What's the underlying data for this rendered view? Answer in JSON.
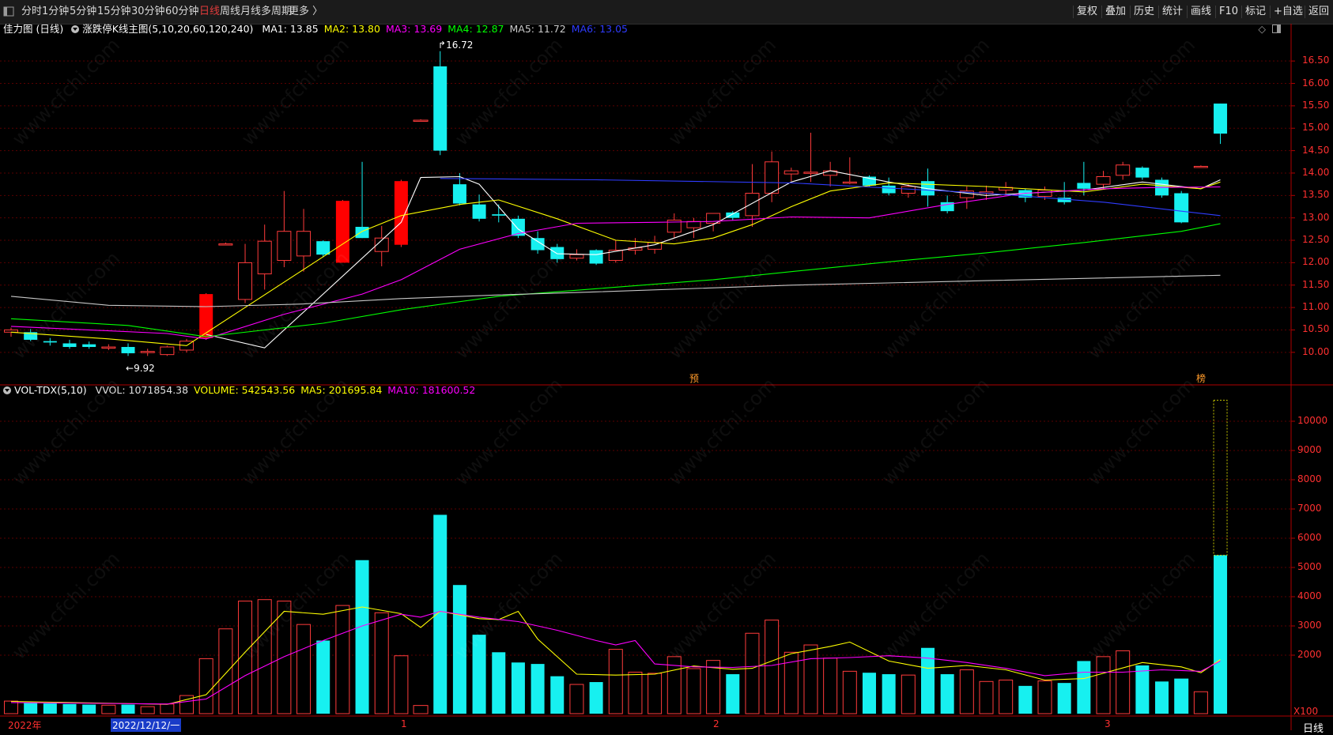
{
  "toolbar": {
    "corner_icon": "panel-toggle-icon",
    "periods": [
      {
        "label": "分时",
        "active": false
      },
      {
        "label": "1分钟",
        "active": false
      },
      {
        "label": "5分钟",
        "active": false
      },
      {
        "label": "15分钟",
        "active": false
      },
      {
        "label": "30分钟",
        "active": false
      },
      {
        "label": "60分钟",
        "active": false
      },
      {
        "label": "日线",
        "active": true
      },
      {
        "label": "周线",
        "active": false
      },
      {
        "label": "月线",
        "active": false
      },
      {
        "label": "多周期",
        "active": false
      },
      {
        "label": "更多 〉",
        "active": false
      }
    ],
    "right_buttons": [
      "复权",
      "叠加",
      "历史",
      "统计",
      "画线",
      "F10",
      "标记",
      "+自选",
      "返回"
    ]
  },
  "main_legend": {
    "title": "佳力图 (日线)",
    "indicator": "涨跌停K线主图(5,10,20,60,120,240)",
    "ma": [
      {
        "label": "MA1: 13.85",
        "color": "#ffffff"
      },
      {
        "label": "MA2: 13.80",
        "color": "#ffff00"
      },
      {
        "label": "MA3: 13.69",
        "color": "#ff00ff"
      },
      {
        "label": "MA4: 12.87",
        "color": "#00ff00"
      },
      {
        "label": "MA5: 11.72",
        "color": "#cccccc"
      },
      {
        "label": "MA6: 13.05",
        "color": "#2f3cff"
      }
    ],
    "icons": [
      "diamond-icon",
      "panel-icon"
    ]
  },
  "vol_legend": {
    "indicator": "VOL-TDX(5,10)",
    "items": [
      {
        "label": "VVOL: 1071854.38",
        "color": "#e0e0e0"
      },
      {
        "label": "VOLUME: 542543.56",
        "color": "#ffff00"
      },
      {
        "label": "MA5: 201695.84",
        "color": "#ffff00"
      },
      {
        "label": "MA10: 181600.52",
        "color": "#ff00ff"
      }
    ]
  },
  "price_axis": [
    "16.50",
    "16.00",
    "15.50",
    "15.00",
    "14.50",
    "14.00",
    "13.50",
    "13.00",
    "12.50",
    "12.00",
    "11.50",
    "11.00",
    "10.50",
    "10.00"
  ],
  "vol_axis": [
    "10000",
    "9000",
    "8000",
    "7000",
    "6000",
    "5000",
    "4000",
    "3000",
    "2000"
  ],
  "vol_unit": "X100",
  "period_label": "日线",
  "markers": {
    "high": "16.72",
    "low": "9.92",
    "yu": "预",
    "bang": "榜"
  },
  "date_axis": {
    "year": "2022年",
    "cursor_date": "2022/12/12/一",
    "months": [
      "1",
      "2",
      "3"
    ]
  },
  "watermark": "www.cfchi.com",
  "chart_data": {
    "type": "candlestick",
    "ylim": [
      9.7,
      16.8
    ],
    "vol_ylim": [
      0,
      10800
    ],
    "candles": [
      {
        "o": 10.45,
        "h": 10.55,
        "l": 10.35,
        "c": 10.5,
        "v": 430
      },
      {
        "o": 10.45,
        "h": 10.52,
        "l": 10.25,
        "c": 10.28,
        "v": 380
      },
      {
        "o": 10.25,
        "h": 10.32,
        "l": 10.15,
        "c": 10.22,
        "v": 350
      },
      {
        "o": 10.2,
        "h": 10.28,
        "l": 10.08,
        "c": 10.12,
        "v": 330
      },
      {
        "o": 10.18,
        "h": 10.24,
        "l": 10.08,
        "c": 10.12,
        "v": 310
      },
      {
        "o": 10.1,
        "h": 10.18,
        "l": 10.05,
        "c": 10.12,
        "v": 290
      },
      {
        "o": 10.12,
        "h": 10.2,
        "l": 9.92,
        "c": 9.98,
        "v": 310
      },
      {
        "o": 10.0,
        "h": 10.08,
        "l": 9.92,
        "c": 10.02,
        "v": 240
      },
      {
        "o": 9.95,
        "h": 10.15,
        "l": 9.92,
        "c": 10.12,
        "v": 330
      },
      {
        "o": 10.05,
        "h": 10.3,
        "l": 10.0,
        "c": 10.25,
        "v": 620
      },
      {
        "o": 10.32,
        "h": 11.32,
        "l": 10.28,
        "c": 11.3,
        "v": 1880
      },
      {
        "o": 12.42,
        "h": 12.45,
        "l": 12.4,
        "c": 12.42,
        "v": 2900
      },
      {
        "o": 11.18,
        "h": 12.42,
        "l": 11.1,
        "c": 12.0,
        "v": 3850
      },
      {
        "o": 11.75,
        "h": 12.85,
        "l": 11.4,
        "c": 12.48,
        "v": 3900
      },
      {
        "o": 12.05,
        "h": 13.6,
        "l": 11.9,
        "c": 12.7,
        "v": 3850
      },
      {
        "o": 12.15,
        "h": 13.2,
        "l": 11.8,
        "c": 12.7,
        "v": 3050
      },
      {
        "o": 12.48,
        "h": 12.5,
        "l": 12.12,
        "c": 12.18,
        "v": 2500
      },
      {
        "o": 12.0,
        "h": 13.4,
        "l": 12.0,
        "c": 13.38,
        "v": 3700
      },
      {
        "o": 12.8,
        "h": 14.25,
        "l": 12.55,
        "c": 12.55,
        "v": 5250
      },
      {
        "o": 12.25,
        "h": 12.82,
        "l": 11.92,
        "c": 12.55,
        "v": 3450
      },
      {
        "o": 12.4,
        "h": 13.85,
        "l": 12.35,
        "c": 13.82,
        "v": 1980
      },
      {
        "o": 15.18,
        "h": 15.2,
        "l": 15.16,
        "c": 15.18,
        "v": 280
      },
      {
        "o": 16.38,
        "h": 16.72,
        "l": 14.4,
        "c": 14.5,
        "v": 6800
      },
      {
        "o": 13.75,
        "h": 14.0,
        "l": 13.28,
        "c": 13.32,
        "v": 4400
      },
      {
        "o": 13.3,
        "h": 13.52,
        "l": 12.92,
        "c": 12.98,
        "v": 2700
      },
      {
        "o": 13.08,
        "h": 13.3,
        "l": 12.9,
        "c": 13.05,
        "v": 2100
      },
      {
        "o": 12.98,
        "h": 13.05,
        "l": 12.55,
        "c": 12.6,
        "v": 1750
      },
      {
        "o": 12.55,
        "h": 12.7,
        "l": 12.2,
        "c": 12.28,
        "v": 1700
      },
      {
        "o": 12.35,
        "h": 12.42,
        "l": 12.0,
        "c": 12.08,
        "v": 1280
      },
      {
        "o": 12.1,
        "h": 12.3,
        "l": 12.05,
        "c": 12.18,
        "v": 1000
      },
      {
        "o": 12.28,
        "h": 12.3,
        "l": 11.95,
        "c": 11.98,
        "v": 1080
      },
      {
        "o": 12.05,
        "h": 12.5,
        "l": 12.0,
        "c": 12.28,
        "v": 2200
      },
      {
        "o": 12.28,
        "h": 12.55,
        "l": 12.18,
        "c": 12.33,
        "v": 1420
      },
      {
        "o": 12.3,
        "h": 12.6,
        "l": 12.2,
        "c": 12.45,
        "v": 1380
      },
      {
        "o": 12.68,
        "h": 13.1,
        "l": 12.55,
        "c": 12.95,
        "v": 1950
      },
      {
        "o": 12.78,
        "h": 13.0,
        "l": 12.55,
        "c": 12.92,
        "v": 1540
      },
      {
        "o": 12.88,
        "h": 13.1,
        "l": 12.7,
        "c": 13.1,
        "v": 1820
      },
      {
        "o": 13.12,
        "h": 13.15,
        "l": 12.95,
        "c": 13.0,
        "v": 1350
      },
      {
        "o": 13.05,
        "h": 14.2,
        "l": 12.8,
        "c": 13.55,
        "v": 2750
      },
      {
        "o": 13.55,
        "h": 14.48,
        "l": 13.35,
        "c": 14.25,
        "v": 3200
      },
      {
        "o": 13.98,
        "h": 14.12,
        "l": 13.82,
        "c": 14.05,
        "v": 2100
      },
      {
        "o": 14.02,
        "h": 14.9,
        "l": 13.8,
        "c": 14.02,
        "v": 2350
      },
      {
        "o": 13.95,
        "h": 14.25,
        "l": 13.7,
        "c": 14.05,
        "v": 1900
      },
      {
        "o": 13.8,
        "h": 14.35,
        "l": 13.75,
        "c": 13.8,
        "v": 1450
      },
      {
        "o": 13.92,
        "h": 13.95,
        "l": 13.7,
        "c": 13.72,
        "v": 1400
      },
      {
        "o": 13.72,
        "h": 13.9,
        "l": 13.5,
        "c": 13.55,
        "v": 1350
      },
      {
        "o": 13.55,
        "h": 13.75,
        "l": 13.45,
        "c": 13.7,
        "v": 1320
      },
      {
        "o": 13.82,
        "h": 14.1,
        "l": 13.25,
        "c": 13.5,
        "v": 2250
      },
      {
        "o": 13.35,
        "h": 13.5,
        "l": 13.1,
        "c": 13.15,
        "v": 1350
      },
      {
        "o": 13.45,
        "h": 13.7,
        "l": 13.2,
        "c": 13.6,
        "v": 1500
      },
      {
        "o": 13.55,
        "h": 13.72,
        "l": 13.4,
        "c": 13.58,
        "v": 1100
      },
      {
        "o": 13.62,
        "h": 13.8,
        "l": 13.5,
        "c": 13.68,
        "v": 1150
      },
      {
        "o": 13.62,
        "h": 13.65,
        "l": 13.35,
        "c": 13.45,
        "v": 950
      },
      {
        "o": 13.48,
        "h": 13.7,
        "l": 13.4,
        "c": 13.62,
        "v": 1120
      },
      {
        "o": 13.45,
        "h": 13.8,
        "l": 13.3,
        "c": 13.35,
        "v": 1050
      },
      {
        "o": 13.78,
        "h": 14.25,
        "l": 13.5,
        "c": 13.65,
        "v": 1800
      },
      {
        "o": 13.75,
        "h": 14.05,
        "l": 13.65,
        "c": 13.92,
        "v": 1950
      },
      {
        "o": 13.95,
        "h": 14.25,
        "l": 13.85,
        "c": 14.18,
        "v": 2150
      },
      {
        "o": 14.12,
        "h": 14.15,
        "l": 13.85,
        "c": 13.9,
        "v": 1650
      },
      {
        "o": 13.85,
        "h": 13.9,
        "l": 13.45,
        "c": 13.5,
        "v": 1100
      },
      {
        "o": 13.55,
        "h": 13.6,
        "l": 12.88,
        "c": 12.9,
        "v": 1200
      },
      {
        "o": 14.15,
        "h": 14.17,
        "l": 14.13,
        "c": 14.15,
        "v": 750
      },
      {
        "o": 15.55,
        "h": 15.55,
        "l": 14.65,
        "c": 14.88,
        "v": 5420,
        "vv": 10720
      }
    ],
    "ma_lines": [
      {
        "name": "MA1",
        "color": "#ffffff",
        "points": [
          [
            10,
            10.4
          ],
          [
            13,
            10.1
          ],
          [
            20,
            12.9
          ],
          [
            21,
            13.9
          ],
          [
            23,
            13.92
          ],
          [
            24,
            13.75
          ],
          [
            26,
            12.75
          ],
          [
            28,
            12.2
          ],
          [
            30,
            12.18
          ],
          [
            33,
            12.4
          ],
          [
            36,
            12.85
          ],
          [
            40,
            13.8
          ],
          [
            42,
            14.05
          ],
          [
            45,
            13.8
          ],
          [
            47,
            13.65
          ],
          [
            50,
            13.5
          ],
          [
            55,
            13.62
          ],
          [
            58,
            13.8
          ],
          [
            60,
            13.7
          ],
          [
            61,
            13.65
          ],
          [
            62,
            13.85
          ]
        ]
      },
      {
        "name": "MA2",
        "color": "#ffff00",
        "points": [
          [
            0,
            10.45
          ],
          [
            5,
            10.3
          ],
          [
            9,
            10.15
          ],
          [
            12,
            11.0
          ],
          [
            15,
            11.85
          ],
          [
            18,
            12.7
          ],
          [
            20,
            13.05
          ],
          [
            23,
            13.3
          ],
          [
            25,
            13.4
          ],
          [
            28,
            12.98
          ],
          [
            31,
            12.5
          ],
          [
            34,
            12.42
          ],
          [
            36,
            12.55
          ],
          [
            38,
            12.85
          ],
          [
            40,
            13.25
          ],
          [
            42,
            13.6
          ],
          [
            45,
            13.78
          ],
          [
            50,
            13.7
          ],
          [
            55,
            13.58
          ],
          [
            58,
            13.75
          ],
          [
            61,
            13.65
          ],
          [
            62,
            13.8
          ]
        ]
      },
      {
        "name": "MA3",
        "color": "#ff00ff",
        "points": [
          [
            0,
            10.58
          ],
          [
            8,
            10.42
          ],
          [
            10,
            10.3
          ],
          [
            14,
            10.85
          ],
          [
            18,
            11.3
          ],
          [
            20,
            11.62
          ],
          [
            23,
            12.3
          ],
          [
            26,
            12.65
          ],
          [
            29,
            12.88
          ],
          [
            33,
            12.9
          ],
          [
            36,
            12.92
          ],
          [
            40,
            13.02
          ],
          [
            44,
            13.0
          ],
          [
            48,
            13.3
          ],
          [
            52,
            13.55
          ],
          [
            56,
            13.65
          ],
          [
            59,
            13.68
          ],
          [
            62,
            13.69
          ]
        ]
      },
      {
        "name": "MA4",
        "color": "#00ff00",
        "points": [
          [
            0,
            10.75
          ],
          [
            6,
            10.6
          ],
          [
            10,
            10.35
          ],
          [
            16,
            10.65
          ],
          [
            20,
            10.95
          ],
          [
            25,
            11.25
          ],
          [
            30,
            11.42
          ],
          [
            36,
            11.62
          ],
          [
            40,
            11.8
          ],
          [
            45,
            12.02
          ],
          [
            50,
            12.22
          ],
          [
            55,
            12.45
          ],
          [
            60,
            12.7
          ],
          [
            62,
            12.87
          ]
        ]
      },
      {
        "name": "MA5",
        "color": "#c8c8c8",
        "points": [
          [
            0,
            11.25
          ],
          [
            5,
            11.05
          ],
          [
            10,
            11.02
          ],
          [
            15,
            11.08
          ],
          [
            20,
            11.2
          ],
          [
            25,
            11.28
          ],
          [
            30,
            11.35
          ],
          [
            40,
            11.5
          ],
          [
            50,
            11.6
          ],
          [
            62,
            11.72
          ]
        ]
      },
      {
        "name": "MA6",
        "color": "#2f3cff",
        "points": [
          [
            22,
            13.88
          ],
          [
            30,
            13.85
          ],
          [
            40,
            13.78
          ],
          [
            50,
            13.55
          ],
          [
            56,
            13.35
          ],
          [
            60,
            13.15
          ],
          [
            62,
            13.05
          ]
        ]
      }
    ],
    "vol_ma_lines": [
      {
        "name": "MA5",
        "color": "#ffff00",
        "points": [
          [
            0,
            420
          ],
          [
            8,
            320
          ],
          [
            10,
            650
          ],
          [
            12,
            2100
          ],
          [
            14,
            3500
          ],
          [
            16,
            3400
          ],
          [
            18,
            3650
          ],
          [
            20,
            3420
          ],
          [
            21,
            2950
          ],
          [
            22,
            3500
          ],
          [
            24,
            3250
          ],
          [
            25,
            3220
          ],
          [
            26,
            3500
          ],
          [
            27,
            2550
          ],
          [
            29,
            1350
          ],
          [
            31,
            1320
          ],
          [
            33,
            1350
          ],
          [
            35,
            1630
          ],
          [
            37,
            1520
          ],
          [
            38,
            1550
          ],
          [
            40,
            2050
          ],
          [
            42,
            2300
          ],
          [
            43,
            2450
          ],
          [
            45,
            1800
          ],
          [
            47,
            1550
          ],
          [
            49,
            1650
          ],
          [
            51,
            1500
          ],
          [
            53,
            1150
          ],
          [
            55,
            1200
          ],
          [
            58,
            1750
          ],
          [
            60,
            1600
          ],
          [
            61,
            1400
          ],
          [
            62,
            1850
          ]
        ]
      },
      {
        "name": "MA10",
        "color": "#ff00ff",
        "points": [
          [
            0,
            380
          ],
          [
            8,
            330
          ],
          [
            10,
            500
          ],
          [
            12,
            1300
          ],
          [
            14,
            1950
          ],
          [
            16,
            2500
          ],
          [
            18,
            3000
          ],
          [
            20,
            3400
          ],
          [
            21,
            3300
          ],
          [
            22,
            3500
          ],
          [
            24,
            3300
          ],
          [
            26,
            3150
          ],
          [
            28,
            2850
          ],
          [
            30,
            2500
          ],
          [
            31,
            2350
          ],
          [
            32,
            2500
          ],
          [
            33,
            1700
          ],
          [
            35,
            1600
          ],
          [
            37,
            1580
          ],
          [
            39,
            1650
          ],
          [
            41,
            1880
          ],
          [
            43,
            1920
          ],
          [
            45,
            1980
          ],
          [
            47,
            1900
          ],
          [
            49,
            1750
          ],
          [
            51,
            1550
          ],
          [
            53,
            1300
          ],
          [
            55,
            1420
          ],
          [
            57,
            1420
          ],
          [
            59,
            1500
          ],
          [
            61,
            1450
          ],
          [
            62,
            1800
          ]
        ]
      }
    ]
  }
}
